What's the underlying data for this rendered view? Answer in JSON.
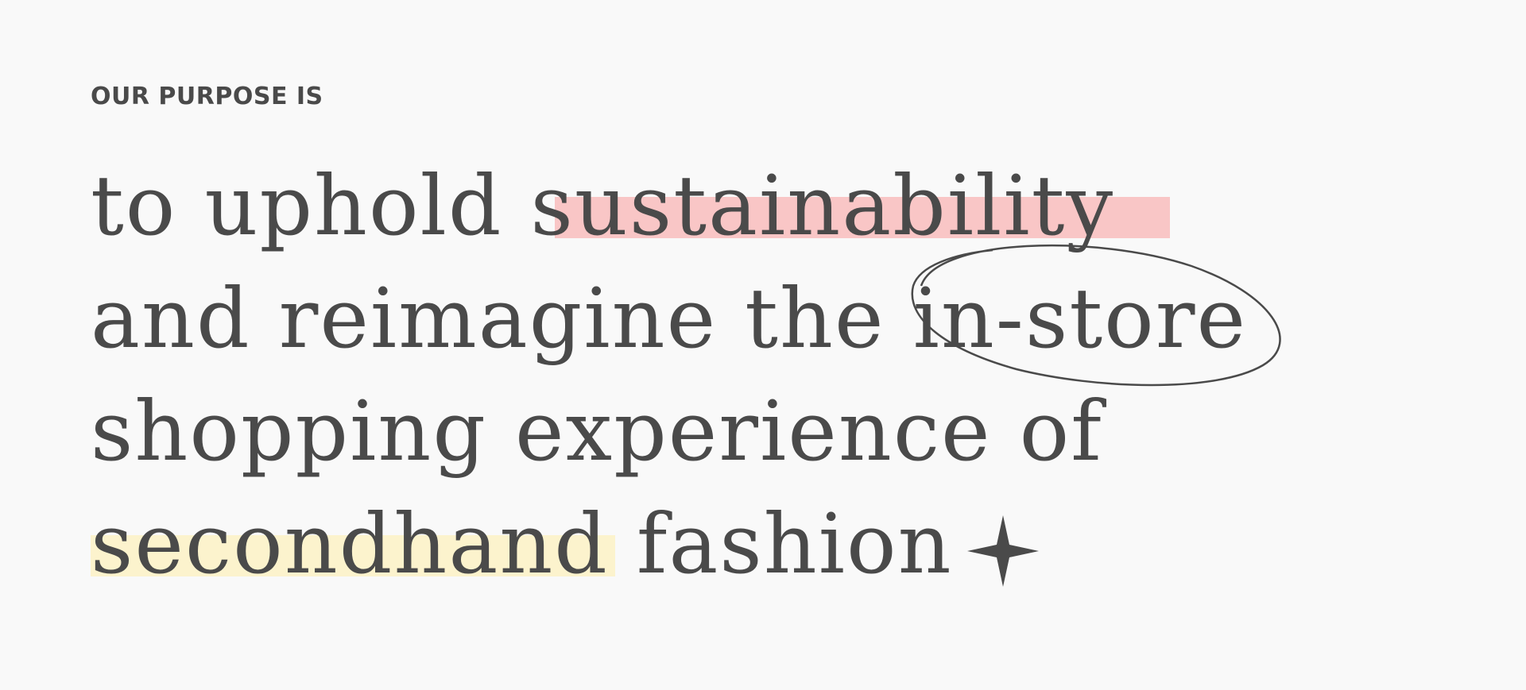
{
  "eyebrow": "OUR PURPOSE IS",
  "headline": {
    "line1_pre": "to uphold ",
    "line1_highlight": "sustainability",
    "line2_pre": "and reimagine the ",
    "line2_circled": "in-store",
    "line3": "shopping experience of",
    "line4_highlight": "secondhand",
    "line4_post": " fashion"
  },
  "colors": {
    "background": "#f9f9f9",
    "text": "#4a4a4a",
    "highlight_pink": "#f9c6c6",
    "highlight_yellow": "#fcf3cd"
  },
  "icons": {
    "decoration": "sparkle-star-icon"
  }
}
